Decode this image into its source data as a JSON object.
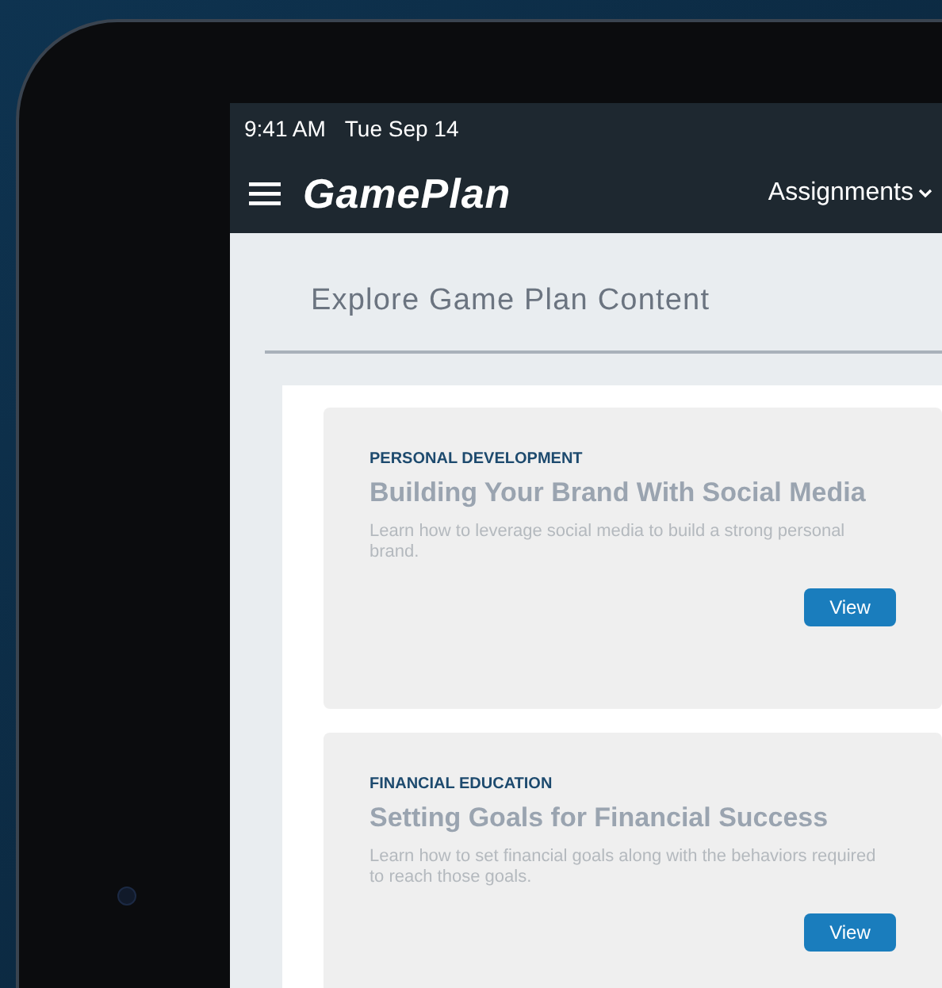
{
  "status_bar": {
    "time": "9:41 AM",
    "date": "Tue Sep 14"
  },
  "header": {
    "logo": "GamePlan",
    "menu": "Assignments"
  },
  "page_title": "Explore Game Plan Content",
  "cards": [
    {
      "category": "PERSONAL DEVELOPMENT",
      "title": "Building Your Brand With Social Media",
      "description": "Learn how to leverage social media to build a strong personal brand.",
      "button": "View"
    },
    {
      "category": "FINANCIAL EDUCATION",
      "title": "Setting Goals for Financial Success",
      "description": "Learn how to set financial goals along with the behaviors required to reach those goals.",
      "button": "View"
    }
  ]
}
